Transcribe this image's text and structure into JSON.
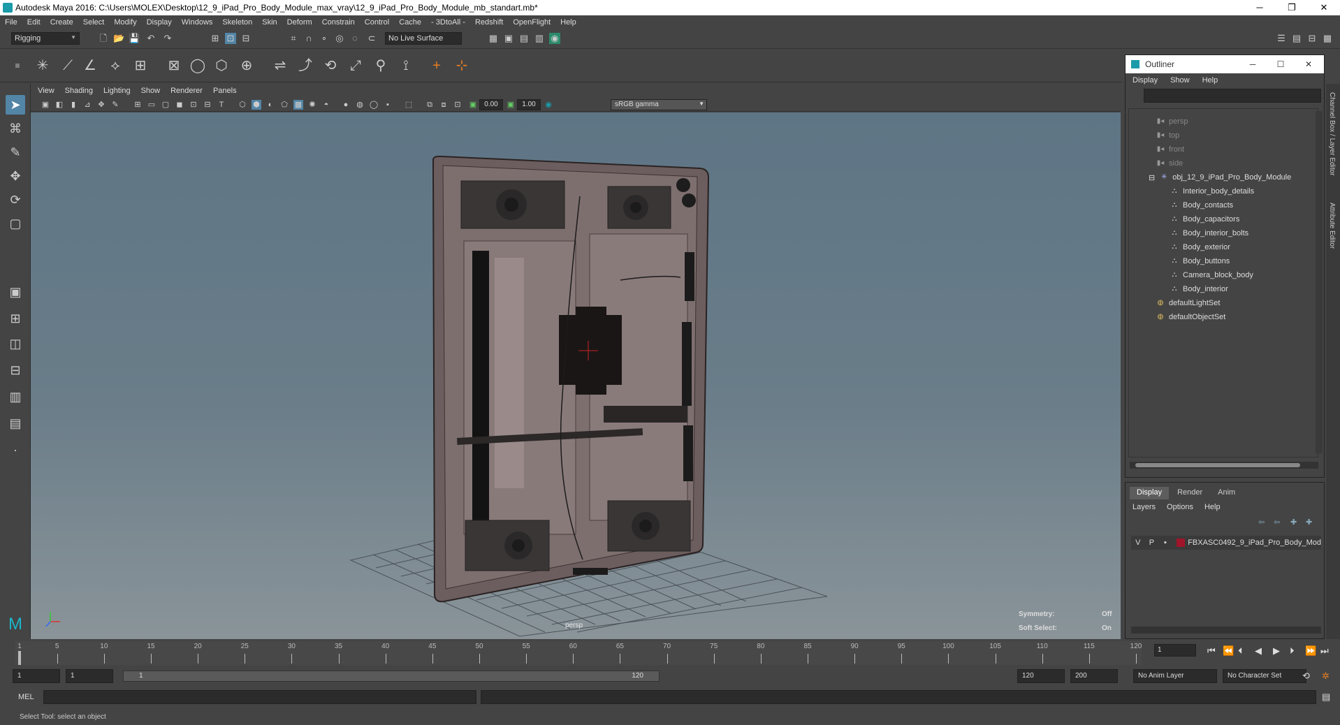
{
  "window": {
    "title": "Autodesk Maya 2016: C:\\Users\\MOLEX\\Desktop\\12_9_iPad_Pro_Body_Module_max_vray\\12_9_iPad_Pro_Body_Module_mb_standart.mb*",
    "min": "─",
    "max": "❐",
    "close": "✕"
  },
  "menu": [
    "File",
    "Edit",
    "Create",
    "Select",
    "Modify",
    "Display",
    "Windows",
    "Skeleton",
    "Skin",
    "Deform",
    "Constrain",
    "Control",
    "Cache",
    "- 3DtoAll -",
    "Redshift",
    "OpenFlight",
    "Help"
  ],
  "status": {
    "mode": "Rigging",
    "live_surface": "No Live Surface"
  },
  "panel": {
    "menu": [
      "View",
      "Shading",
      "Lighting",
      "Show",
      "Renderer",
      "Panels"
    ],
    "near": "0.00",
    "far": "1.00",
    "color_space": "sRGB gamma"
  },
  "viewport": {
    "camera_label": "persp",
    "symmetry_label": "Symmetry:",
    "symmetry_value": "Off",
    "soft_select_label": "Soft Select:",
    "soft_select_value": "On"
  },
  "outliner": {
    "title": "Outliner",
    "menu": [
      "Display",
      "Show",
      "Help"
    ],
    "items": [
      {
        "label": "persp",
        "type": "camera",
        "level": 1
      },
      {
        "label": "top",
        "type": "camera",
        "level": 1
      },
      {
        "label": "front",
        "type": "camera",
        "level": 1
      },
      {
        "label": "side",
        "type": "camera",
        "level": 1
      },
      {
        "label": "obj_12_9_iPad_Pro_Body_Module",
        "type": "group",
        "level": 0
      },
      {
        "label": "Interior_body_details",
        "type": "mesh",
        "level": 2
      },
      {
        "label": "Body_contacts",
        "type": "mesh",
        "level": 2
      },
      {
        "label": "Body_capacitors",
        "type": "mesh",
        "level": 2
      },
      {
        "label": "Body_interior_bolts",
        "type": "mesh",
        "level": 2
      },
      {
        "label": "Body_exterior",
        "type": "mesh",
        "level": 2
      },
      {
        "label": "Body_buttons",
        "type": "mesh",
        "level": 2
      },
      {
        "label": "Camera_block_body",
        "type": "mesh",
        "level": 2
      },
      {
        "label": "Body_interior",
        "type": "mesh",
        "level": 2
      },
      {
        "label": "defaultLightSet",
        "type": "set",
        "level": 1
      },
      {
        "label": "defaultObjectSet",
        "type": "set",
        "level": 1
      }
    ]
  },
  "layers": {
    "tabs": [
      "Display",
      "Render",
      "Anim"
    ],
    "menu": [
      "Layers",
      "Options",
      "Help"
    ],
    "row": {
      "v": "V",
      "p": "P",
      "name": "FBXASC0492_9_iPad_Pro_Body_Mod",
      "color": "#a0152a"
    }
  },
  "side_tabs": [
    "Channel Box / Layer Editor",
    "Attribute Editor"
  ],
  "timeline": {
    "ticks": [
      "1",
      "5",
      "10",
      "15",
      "20",
      "25",
      "30",
      "35",
      "40",
      "45",
      "50",
      "55",
      "60",
      "65",
      "70",
      "75",
      "80",
      "85",
      "90",
      "95",
      "100",
      "105",
      "110",
      "115",
      "120"
    ],
    "current_frame": "1"
  },
  "range": {
    "start": "1",
    "playback_start": "1",
    "slider_start": "1",
    "slider_end": "120",
    "playback_end": "120",
    "end": "200",
    "anim_layer": "No Anim Layer",
    "char_set": "No Character Set"
  },
  "command": {
    "lang": "MEL"
  },
  "help": "Select Tool: select an object"
}
